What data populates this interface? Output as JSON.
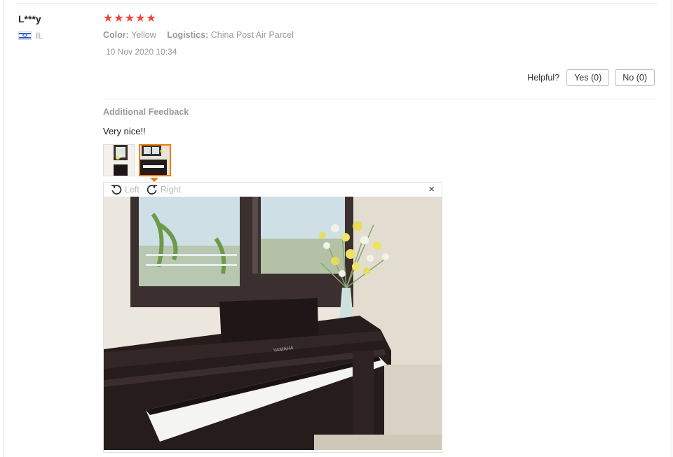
{
  "review": {
    "user": {
      "name": "L***y",
      "country": "IL",
      "flag_icon": "israel-flag-icon"
    },
    "rating": 5,
    "stars": [
      "★",
      "★",
      "★",
      "★",
      "★"
    ],
    "color_label": "Color:",
    "color_value": "Yellow",
    "logistics_label": "Logistics:",
    "logistics_value": "China Post Air Parcel",
    "date": "10 Nov 2020 10:34",
    "helpful": {
      "label": "Helpful?",
      "yes": "Yes (0)",
      "no": "No (0)"
    },
    "additional": {
      "title": "Additional Feedback",
      "text": "Very nice!!"
    },
    "viewer": {
      "rotate_left": "Left",
      "rotate_right": "Right",
      "close": "×"
    }
  },
  "colors": {
    "star": "#f44336",
    "thumb_active": "#f57c00",
    "muted_text": "#999999"
  }
}
